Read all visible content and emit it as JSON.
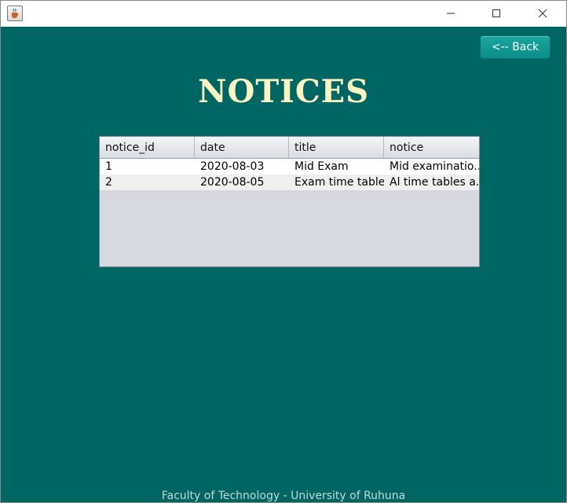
{
  "window": {
    "icon": "java-cup-icon",
    "controls": [
      "minimize-icon",
      "maximize-icon",
      "close-icon"
    ]
  },
  "toolbar": {
    "back_label": "<-- Back"
  },
  "page": {
    "title": "NOTICES"
  },
  "table": {
    "columns": [
      "notice_id",
      "date",
      "title",
      "notice"
    ],
    "rows": [
      [
        "1",
        "2020-08-03",
        "Mid Exam",
        "Mid examinatio..."
      ],
      [
        "2",
        "2020-08-05",
        "Exam time table",
        "Al time tables a..."
      ]
    ]
  },
  "footer": {
    "text": "Faculty of Technology - University of Ruhuna"
  },
  "colors": {
    "background": "#006663",
    "title": "#fbf5c2",
    "button": "#0b8e89"
  }
}
